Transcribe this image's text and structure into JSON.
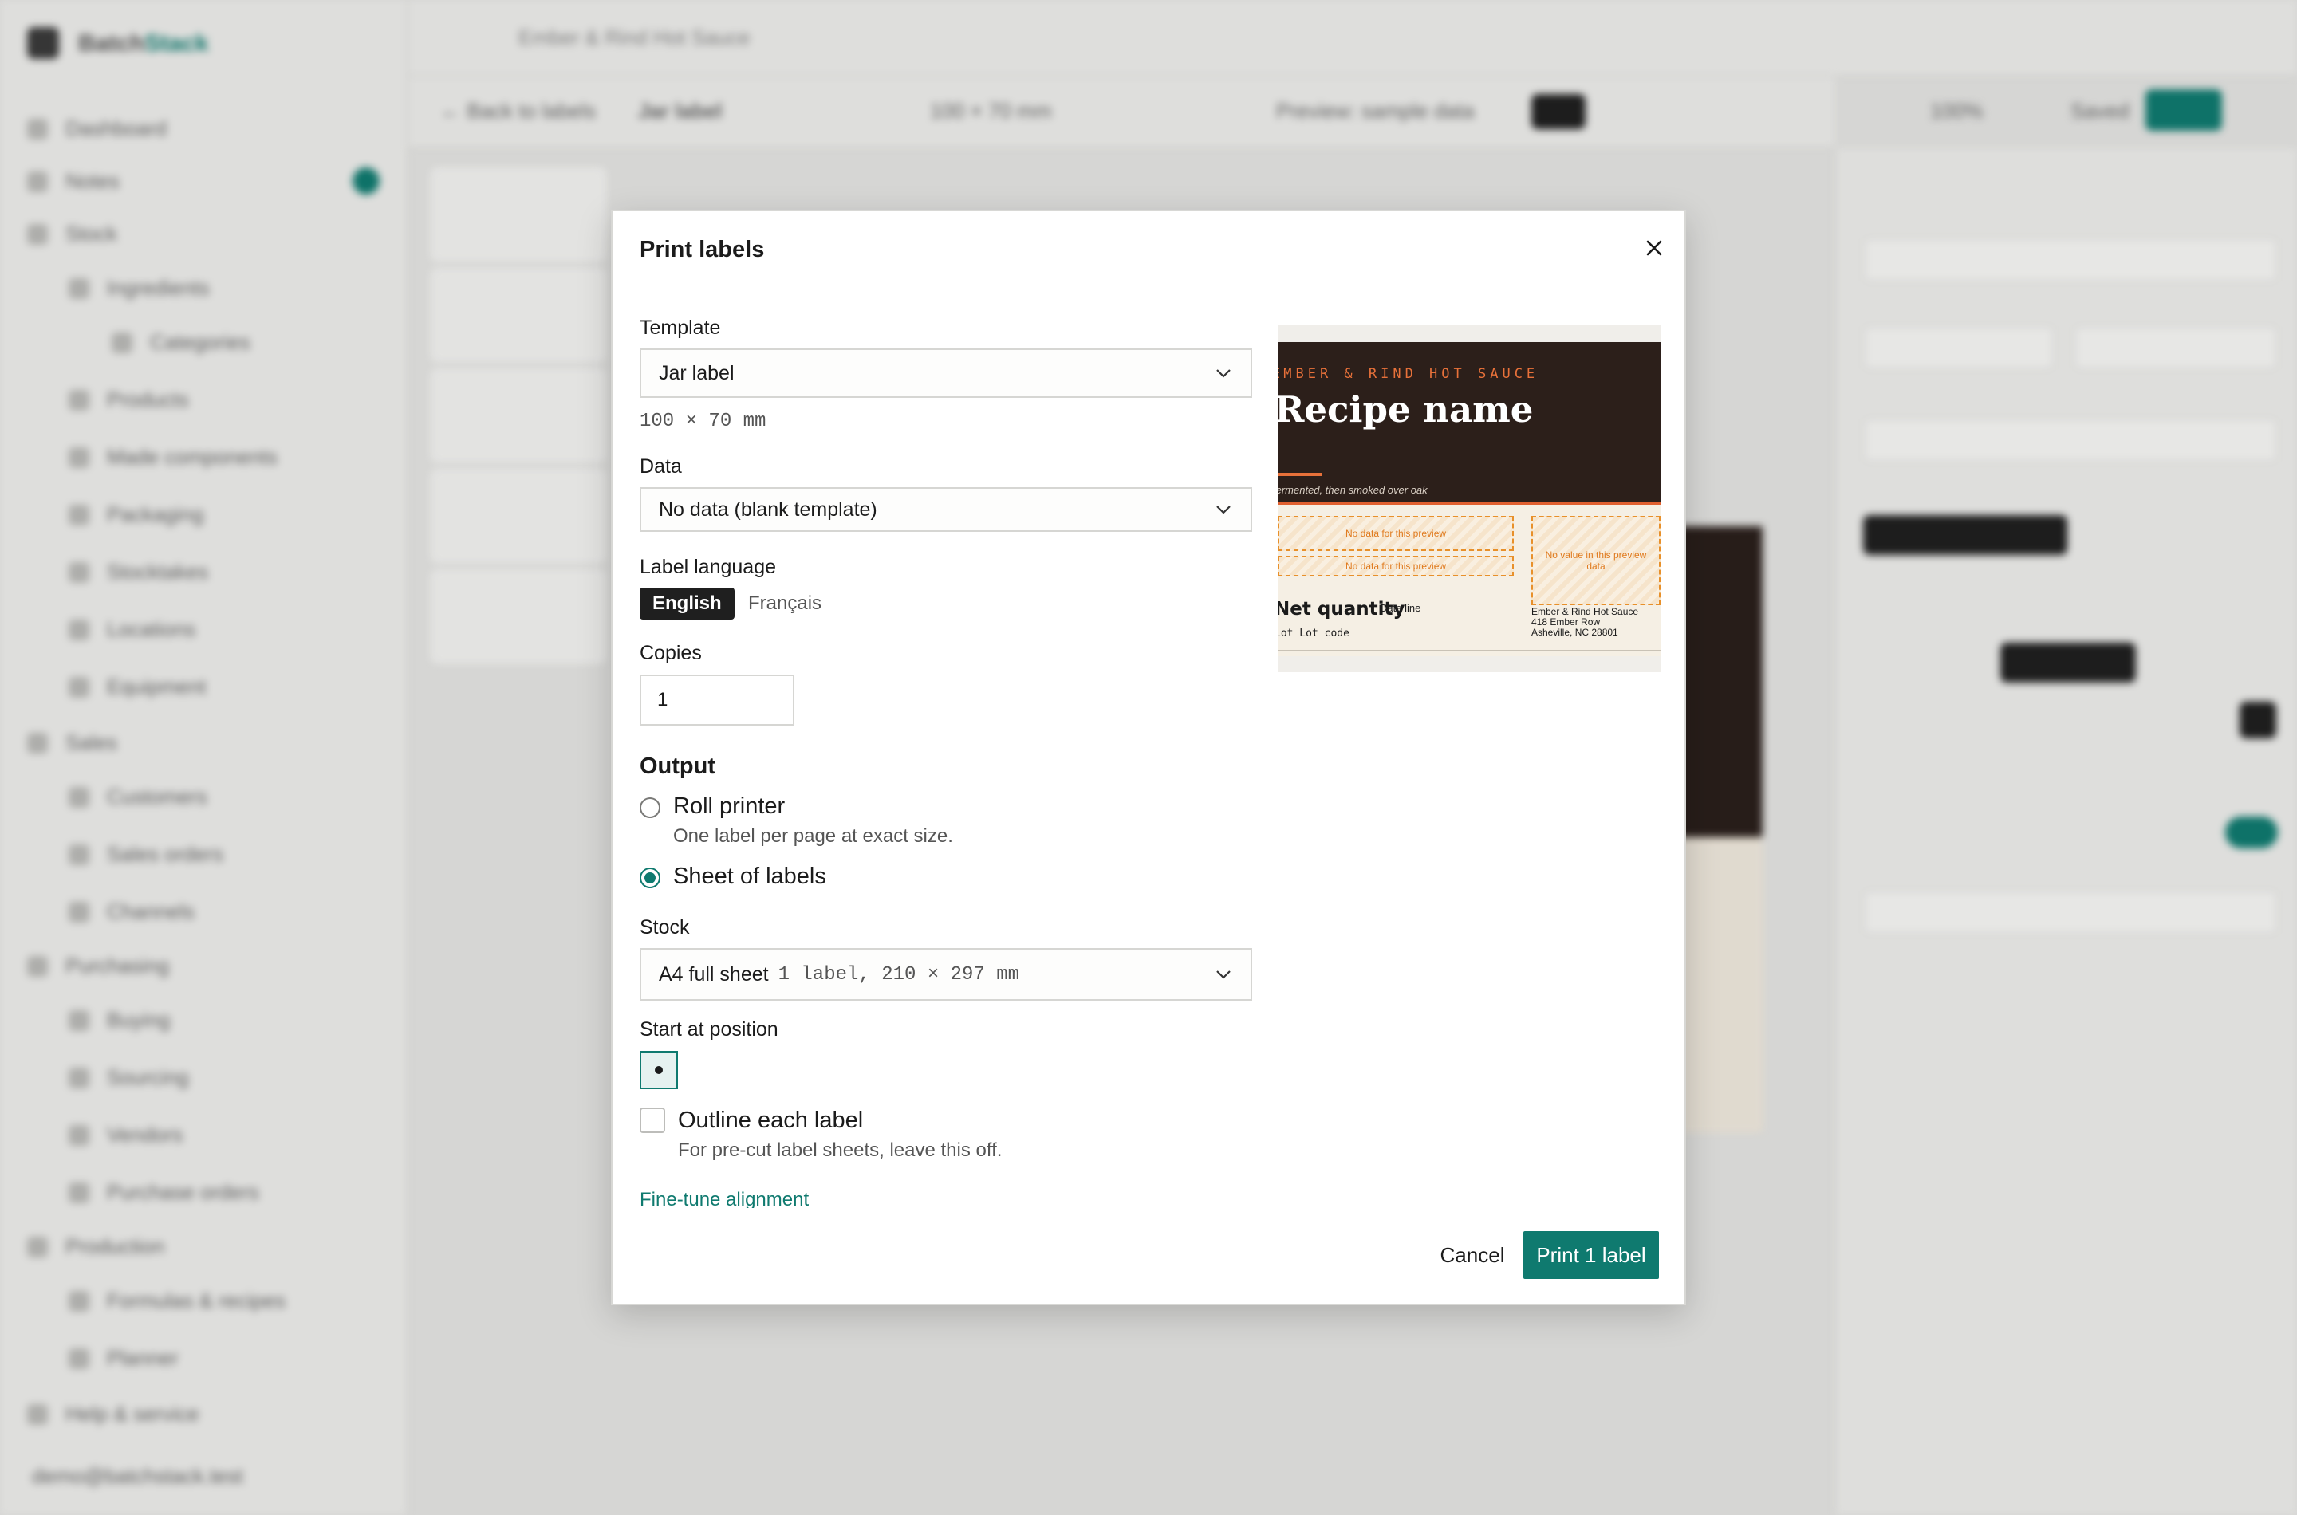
{
  "modal": {
    "title": "Print labels",
    "template_label": "Template",
    "template_value": "Jar label",
    "template_size": "100 × 70 mm",
    "data_label": "Data",
    "data_value": "No data (blank template)",
    "language_label": "Label language",
    "languages": [
      "English",
      "Français"
    ],
    "language_selected": "English",
    "copies_label": "Copies",
    "copies_value": "1",
    "output_heading": "Output",
    "output_options": [
      {
        "label": "Roll printer",
        "description": "One label per page at exact size.",
        "selected": false
      },
      {
        "label": "Sheet of labels",
        "description": "",
        "selected": true
      }
    ],
    "stock_label": "Stock",
    "stock_name": "A4 full sheet",
    "stock_detail": "1 label, 210 × 297 mm",
    "start_position_label": "Start at position",
    "outline_label": "Outline each label",
    "outline_description": "For pre-cut label sheets, leave this off.",
    "outline_checked": false,
    "fine_tune_link": "Fine-tune alignment",
    "cancel_label": "Cancel",
    "print_label": "Print 1 label"
  },
  "preview": {
    "brand": "EMBER & RIND HOT SAUCE",
    "recipe_name": "Recipe name",
    "description": "fermented, then smoked over oak",
    "placeholder_1": "No data for this preview",
    "placeholder_2": "No data for this preview",
    "placeholder_3": "No value in this preview data",
    "net_quantity": "Net quantity",
    "date_line": "Date line",
    "lot_code": "Lot Lot code",
    "address": [
      "Ember & Rind Hot Sauce",
      "418 Ember Row",
      "Asheville, NC 28801"
    ]
  },
  "colors": {
    "accent": "#0f7a6f",
    "label_dark": "#2c1f1a",
    "label_orange": "#e8713a",
    "label_cream": "#f5efe4"
  }
}
